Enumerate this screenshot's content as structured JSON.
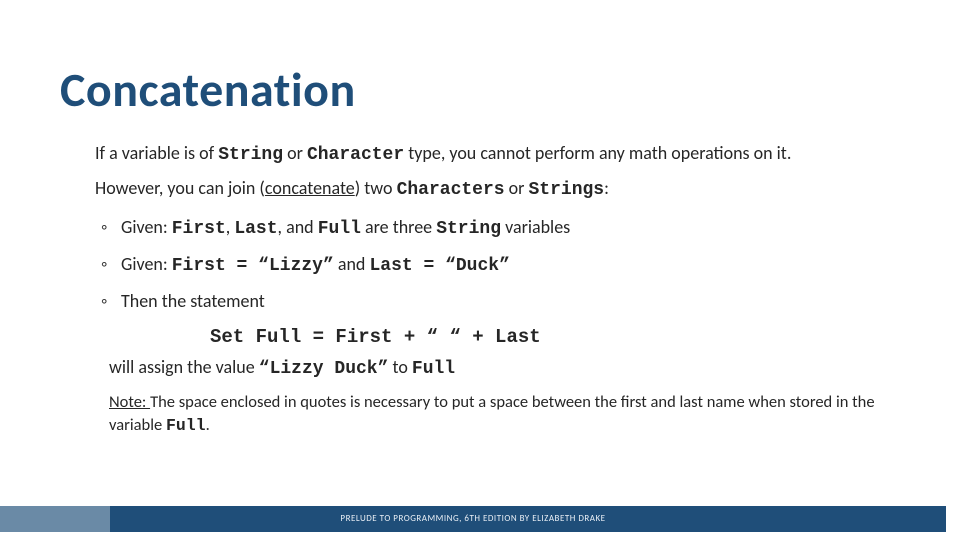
{
  "title": "Concatenation",
  "p1_a": "If a variable is of ",
  "p1_b": "String",
  "p1_c": " or ",
  "p1_d": "Character",
  "p1_e": " type, you cannot perform any math operations on it.",
  "p2_a": "However, you can join (",
  "p2_b": "concatenate",
  "p2_c": ") two ",
  "p2_d": "Characters",
  "p2_e": " or ",
  "p2_f": "Strings",
  "p2_g": ":",
  "b1_a": "Given: ",
  "b1_b": "First",
  "b1_c": ", ",
  "b1_d": "Last",
  "b1_e": ", and ",
  "b1_f": "Full",
  "b1_g": " are three ",
  "b1_h": "String",
  "b1_i": " variables",
  "b2_a": "Given: ",
  "b2_b": "First = “Lizzy”",
  "b2_c": " and ",
  "b2_d": "Last = “Duck”",
  "b3_a": "Then the statement",
  "stmt": "Set Full = First + “ “ + Last",
  "follow_a": "will assign the value ",
  "follow_b": "“Lizzy Duck”",
  "follow_c": " to ",
  "follow_d": "Full",
  "note_label": "Note: ",
  "note_a": "The space enclosed in quotes is necessary to put a space between the first and last name when stored in the variable ",
  "note_b": "Full",
  "note_c": ".",
  "footer": "PRELUDE TO PROGRAMMING, 6TH EDITION BY ELIZABETH DRAKE"
}
